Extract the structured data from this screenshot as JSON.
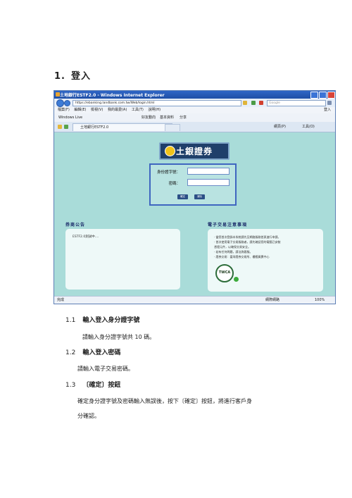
{
  "doc": {
    "heading_num": "1.",
    "heading_text": "登入",
    "sections": [
      {
        "num": "1.1",
        "title": "輸入登入身分證字號",
        "text": "請輸入身分證字號共 10 碼。"
      },
      {
        "num": "1.2",
        "title": "輸入登入密碼",
        "text": "請輸入電子交易密碼。"
      },
      {
        "num": "1.3",
        "title": "〔確定〕按鈕",
        "text_line1": "確定身分證字號及密碼輸入無誤後，按下〔確定〕按鈕，將進行客戶身",
        "text_line2": "分確認。"
      }
    ]
  },
  "browser": {
    "title": "土地銀行ESTF2.0 - Windows Internet Explorer",
    "url": "https://ebanking.landbank.com.tw/Web/login.html",
    "search_placeholder": "Google",
    "menu": [
      "檔案(F)",
      "編輯(E)",
      "檢視(V)",
      "我的最愛(A)",
      "工具(T)",
      "說明(H)"
    ],
    "login_label": "登入",
    "links_bar": {
      "left": "Windows Live",
      "items": [
        "好友動向",
        "基本資料",
        "分享"
      ]
    },
    "tab_title": "土地銀行ESTF2.0",
    "tools": [
      "網頁(P)",
      "工具(O)"
    ],
    "logo_text": "土銀證券",
    "login": {
      "id_label": "身份證字號：",
      "pwd_label": "密碼：",
      "ok_label": "確定",
      "clear_label": "清除"
    },
    "left_heading": "券商公告",
    "right_heading": "電子交易注意事項",
    "announcement": "ESTF2.0測試中....",
    "notices": [
      "‧ 當您首次登錄本系統請先至網路服務首頁進行申請。",
      "‧ 首次使用電子交易服務者，請先確認您的電腦已安裝",
      "  憑證元件，以確保交易安全。",
      "‧ 若有任何問題，請洽詢客服。",
      "‧ 證券交易：臺灣證券交易所、櫃檯買賣中心"
    ],
    "twca": "TWCA",
    "status_left": "完成",
    "status_zone": "網際網路",
    "zoom": "100%"
  }
}
